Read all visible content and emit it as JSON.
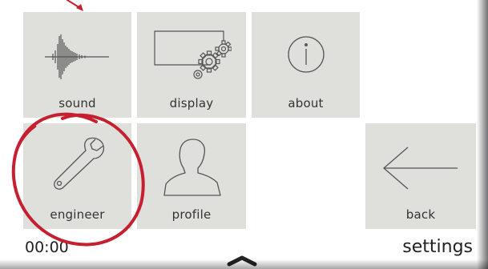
{
  "tiles": {
    "sound": "sound",
    "display": "display",
    "about": "about",
    "engineer": "engineer",
    "profile": "profile",
    "back": "back"
  },
  "status": {
    "clock": "00:00",
    "screen_title": "settings"
  },
  "icons": {
    "sound": "waveform-icon",
    "display": "display-gears-icon",
    "about": "info-icon",
    "engineer": "wrench-icon",
    "profile": "user-silhouette-icon",
    "back": "arrow-left-icon",
    "handle": "chevron-up-icon"
  },
  "colors": {
    "tile_bg": "#dfe0db",
    "icon_stroke": "#555555",
    "annotation": "#c62030"
  }
}
